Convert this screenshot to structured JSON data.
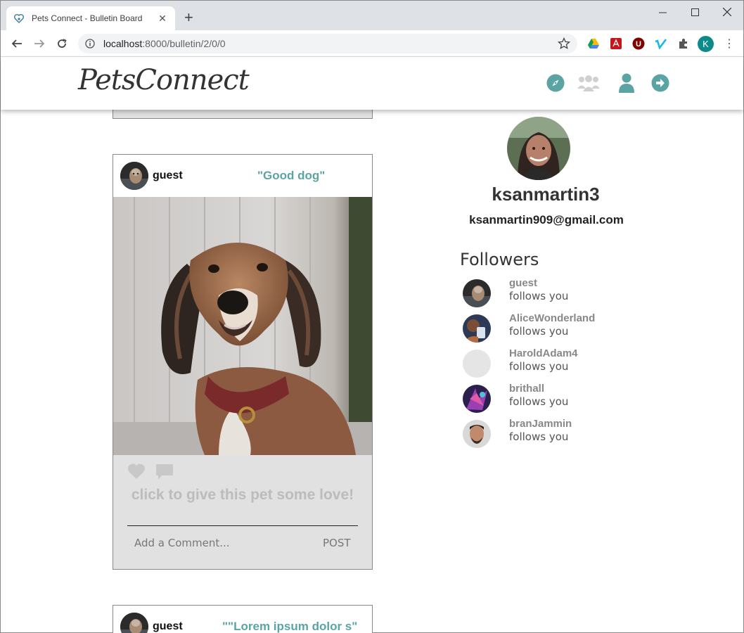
{
  "browser": {
    "tab_title": "Pets Connect - Bulletin Board",
    "url_host": "localhost",
    "url_path": ":8000/bulletin/2/0/0",
    "profile_initial": "K"
  },
  "header": {
    "logo": "PetsConnect",
    "icons": [
      "explore-icon",
      "community-icon",
      "profile-icon",
      "logout-icon"
    ],
    "accent_color": "#5aa4a4"
  },
  "feed": {
    "posts": [
      {
        "user": "guest",
        "caption": "\"Good dog\"",
        "love_text": "click to give this pet some love!",
        "comment_placeholder": "Add a Comment...",
        "post_label": "POST"
      },
      {
        "user": "guest",
        "caption": "\"\"Lorem ipsum dolor s\""
      }
    ]
  },
  "profile": {
    "username": "ksanmartin3",
    "email": "ksanmartin909@gmail.com",
    "followers_title": "Followers",
    "followers": [
      {
        "name": "guest",
        "status": "follows you"
      },
      {
        "name": "AliceWonderland",
        "status": "follows you"
      },
      {
        "name": "HaroldAdam4",
        "status": "follows you"
      },
      {
        "name": "brithall",
        "status": "follows you"
      },
      {
        "name": "branJammin",
        "status": "follows you"
      }
    ]
  }
}
